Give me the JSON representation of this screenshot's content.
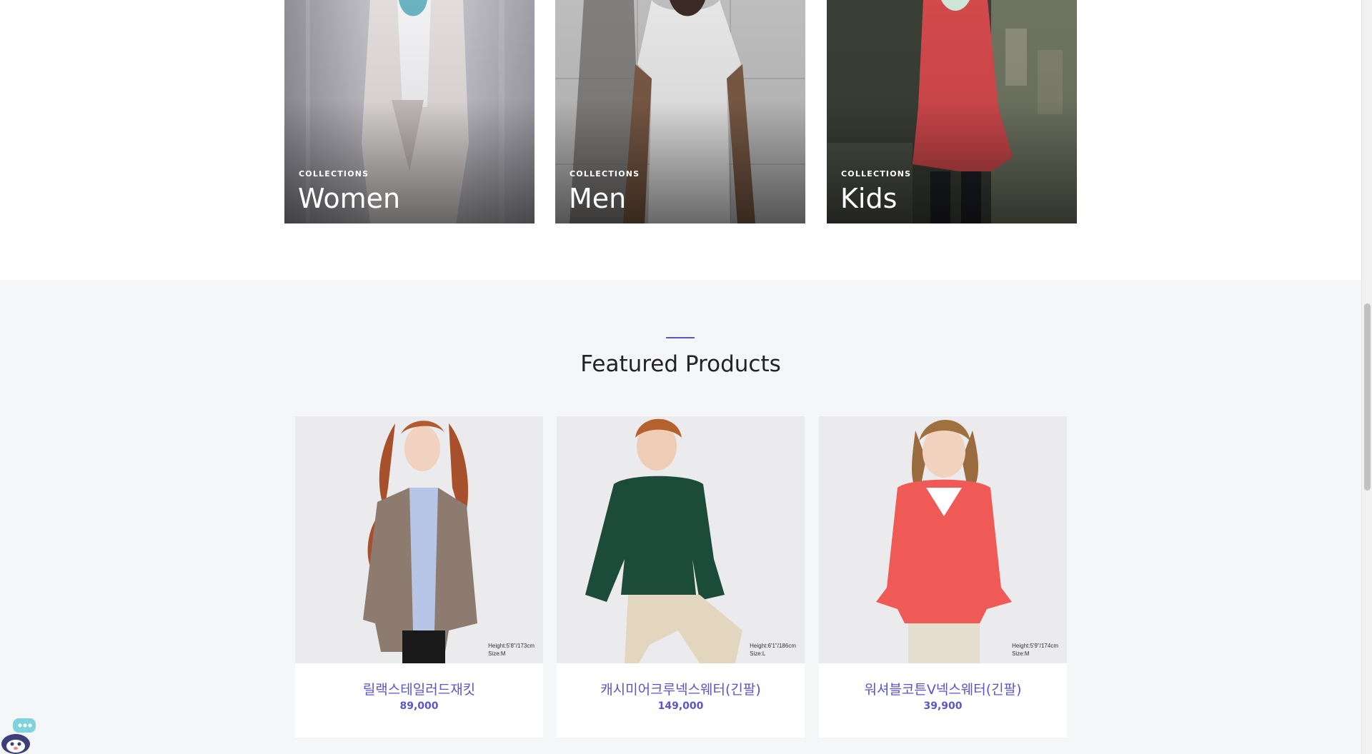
{
  "collections": [
    {
      "kicker": "COLLECTIONS",
      "title": "Women"
    },
    {
      "kicker": "COLLECTIONS",
      "title": "Men"
    },
    {
      "kicker": "COLLECTIONS",
      "title": "Kids"
    }
  ],
  "featured": {
    "title": "Featured Products",
    "products": [
      {
        "name": "릴랙스테일러드재킷",
        "price": "89,000",
        "height_note": "Height:5'8\"/173cm",
        "size_note": "Size:M"
      },
      {
        "name": "캐시미어크루넥스웨터(긴팔)",
        "price": "149,000",
        "height_note": "Height:6'1\"/186cm",
        "size_note": "Size:L"
      },
      {
        "name": "워셔블코튼V넥스웨터(긴팔)",
        "price": "39,900",
        "height_note": "Height:5'9\"/174cm",
        "size_note": "Size:M"
      }
    ]
  },
  "colors": {
    "accent": "#5a55c9",
    "section_bg": "#f5f6f8"
  },
  "icons": {
    "chatbot": "chatbot-icon"
  }
}
